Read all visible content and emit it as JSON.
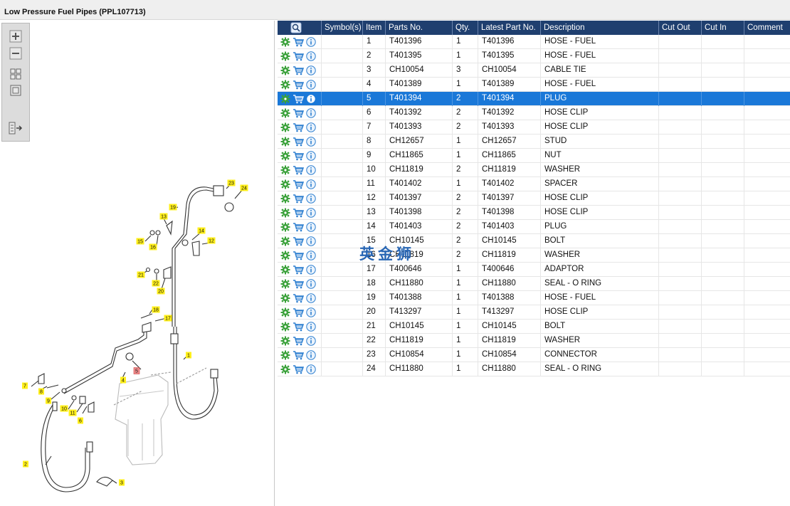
{
  "window": {
    "title": "Low Pressure Fuel Pipes (PPL107713)"
  },
  "toolbox": {
    "tools": [
      {
        "name": "zoom-in-icon"
      },
      {
        "name": "zoom-out-icon"
      },
      {
        "name": "fit-grid-icon"
      },
      {
        "name": "fit-page-icon"
      },
      {
        "name": "list-toggle-icon"
      }
    ]
  },
  "diagram": {
    "callouts": [
      "1",
      "2",
      "3",
      "4",
      "5",
      "6",
      "7",
      "8",
      "9",
      "10",
      "11",
      "12",
      "13",
      "14",
      "15",
      "16",
      "17",
      "18",
      "19",
      "20",
      "21",
      "22",
      "23",
      "24"
    ],
    "highlighted": "5"
  },
  "table": {
    "columns": [
      "Symbol(s)",
      "Item",
      "Parts No.",
      "Qty.",
      "Latest Part No.",
      "Description",
      "Cut Out",
      "Cut In",
      "Comment"
    ],
    "selected_item": "5",
    "rows": [
      {
        "item": "1",
        "part": "T401396",
        "qty": "1",
        "latest": "T401396",
        "desc": "HOSE - FUEL"
      },
      {
        "item": "2",
        "part": "T401395",
        "qty": "1",
        "latest": "T401395",
        "desc": "HOSE - FUEL"
      },
      {
        "item": "3",
        "part": "CH10054",
        "qty": "3",
        "latest": "CH10054",
        "desc": "CABLE TIE"
      },
      {
        "item": "4",
        "part": "T401389",
        "qty": "1",
        "latest": "T401389",
        "desc": "HOSE - FUEL"
      },
      {
        "item": "5",
        "part": "T401394",
        "qty": "2",
        "latest": "T401394",
        "desc": "PLUG"
      },
      {
        "item": "6",
        "part": "T401392",
        "qty": "2",
        "latest": "T401392",
        "desc": "HOSE CLIP"
      },
      {
        "item": "7",
        "part": "T401393",
        "qty": "2",
        "latest": "T401393",
        "desc": "HOSE CLIP"
      },
      {
        "item": "8",
        "part": "CH12657",
        "qty": "1",
        "latest": "CH12657",
        "desc": "STUD"
      },
      {
        "item": "9",
        "part": "CH11865",
        "qty": "1",
        "latest": "CH11865",
        "desc": "NUT"
      },
      {
        "item": "10",
        "part": "CH11819",
        "qty": "2",
        "latest": "CH11819",
        "desc": "WASHER"
      },
      {
        "item": "11",
        "part": "T401402",
        "qty": "1",
        "latest": "T401402",
        "desc": "SPACER"
      },
      {
        "item": "12",
        "part": "T401397",
        "qty": "2",
        "latest": "T401397",
        "desc": "HOSE CLIP"
      },
      {
        "item": "13",
        "part": "T401398",
        "qty": "2",
        "latest": "T401398",
        "desc": "HOSE CLIP"
      },
      {
        "item": "14",
        "part": "T401403",
        "qty": "2",
        "latest": "T401403",
        "desc": "PLUG"
      },
      {
        "item": "15",
        "part": "CH10145",
        "qty": "2",
        "latest": "CH10145",
        "desc": "BOLT"
      },
      {
        "item": "16",
        "part": "CH11819",
        "qty": "2",
        "latest": "CH11819",
        "desc": "WASHER"
      },
      {
        "item": "17",
        "part": "T400646",
        "qty": "1",
        "latest": "T400646",
        "desc": "ADAPTOR"
      },
      {
        "item": "18",
        "part": "CH11880",
        "qty": "1",
        "latest": "CH11880",
        "desc": "SEAL - O RING"
      },
      {
        "item": "19",
        "part": "T401388",
        "qty": "1",
        "latest": "T401388",
        "desc": "HOSE - FUEL"
      },
      {
        "item": "20",
        "part": "T413297",
        "qty": "1",
        "latest": "T413297",
        "desc": "HOSE CLIP"
      },
      {
        "item": "21",
        "part": "CH10145",
        "qty": "1",
        "latest": "CH10145",
        "desc": "BOLT"
      },
      {
        "item": "22",
        "part": "CH11819",
        "qty": "1",
        "latest": "CH11819",
        "desc": "WASHER"
      },
      {
        "item": "23",
        "part": "CH10854",
        "qty": "1",
        "latest": "CH10854",
        "desc": "CONNECTOR"
      },
      {
        "item": "24",
        "part": "CH11880",
        "qty": "1",
        "latest": "CH11880",
        "desc": "SEAL - O RING"
      }
    ]
  },
  "watermark": "英金狮",
  "colors": {
    "header": "#1f3f6f",
    "selected_row": "#1a78d8",
    "callout": "#ffef1a",
    "callout_highlight": "#f08c8c",
    "gear": "#3aa13a",
    "cart": "#2d7fd0",
    "info": "#2d7fd0"
  }
}
